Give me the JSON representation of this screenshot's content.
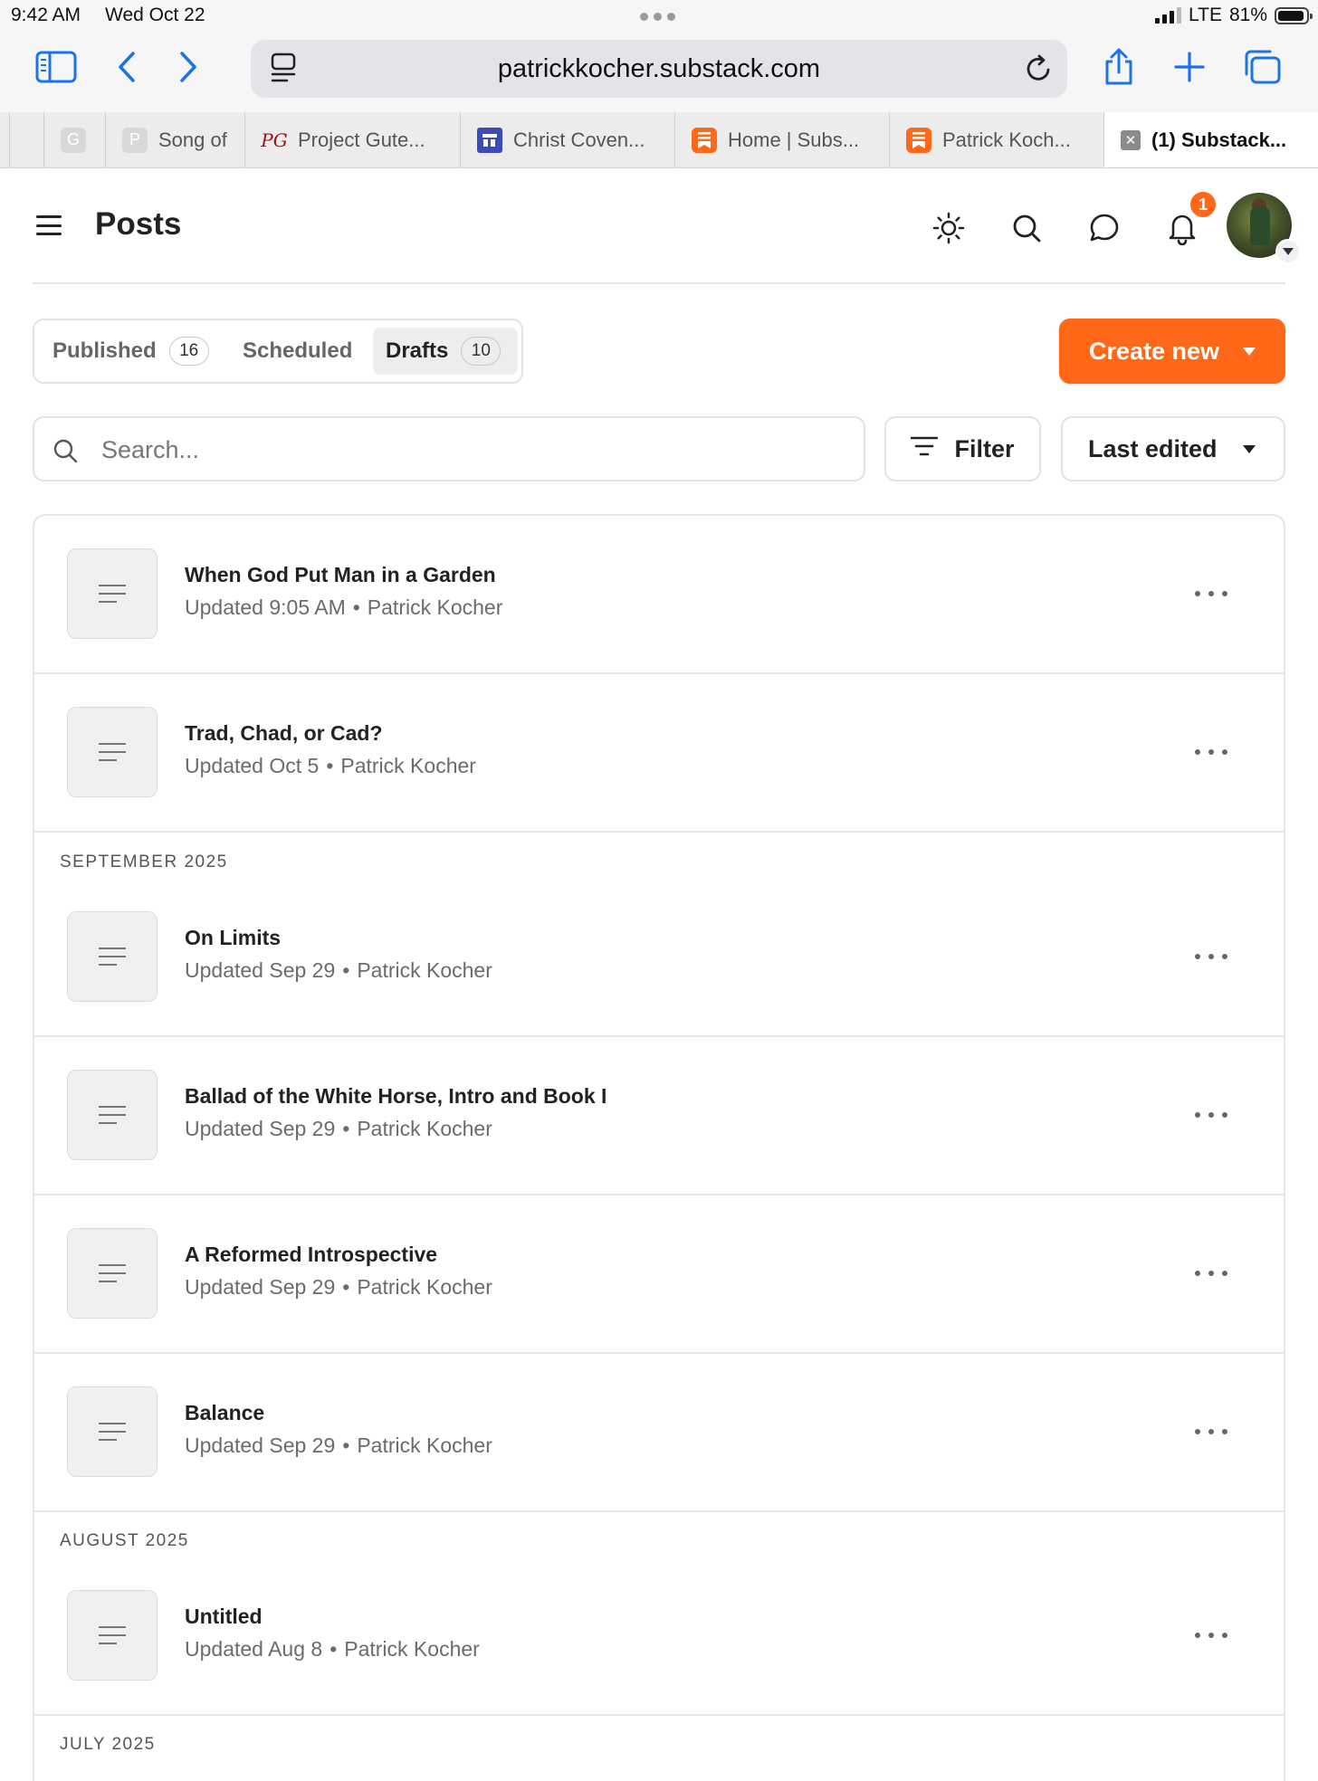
{
  "status_bar": {
    "time": "9:42 AM",
    "date": "Wed Oct 22",
    "network": "LTE",
    "battery": "81%",
    "battery_level": 0.81
  },
  "browser": {
    "url_host": "patrickkocher.substack.com",
    "tabs": [
      {
        "label": "",
        "favicon": "G"
      },
      {
        "label": "Song of",
        "favicon": "P"
      },
      {
        "label": "Project Gute...",
        "favicon": "PG"
      },
      {
        "label": "Christ Coven...",
        "favicon": "calendar-icon"
      },
      {
        "label": "Home | Subs...",
        "favicon": "substack-icon"
      },
      {
        "label": "Patrick Koch...",
        "favicon": "substack-icon"
      },
      {
        "label": "(1) Substack...",
        "favicon": "close-icon",
        "active": true
      }
    ]
  },
  "header": {
    "title": "Posts",
    "notification_count": "1"
  },
  "post_tabs": [
    {
      "label": "Published",
      "count": "16"
    },
    {
      "label": "Scheduled"
    },
    {
      "label": "Drafts",
      "count": "10",
      "active": true
    }
  ],
  "create_button": {
    "label": "Create new"
  },
  "search": {
    "placeholder": "Search..."
  },
  "filter_button": {
    "label": "Filter"
  },
  "sort_button": {
    "label": "Last edited"
  },
  "sections": [
    "SEPTEMBER 2025",
    "AUGUST 2025",
    "JULY 2025"
  ],
  "posts": [
    {
      "title": "When God Put Man in a Garden",
      "updated": "Updated 9:05 AM",
      "author": "Patrick Kocher"
    },
    {
      "title": "Trad, Chad, or Cad?",
      "updated": "Updated Oct 5",
      "author": "Patrick Kocher"
    },
    {
      "title": "On Limits",
      "updated": "Updated Sep 29",
      "author": "Patrick Kocher"
    },
    {
      "title": "Ballad of the White Horse, Intro and Book I",
      "updated": "Updated Sep 29",
      "author": "Patrick Kocher"
    },
    {
      "title": "A Reformed Introspective",
      "updated": "Updated Sep 29",
      "author": "Patrick Kocher"
    },
    {
      "title": "Balance",
      "updated": "Updated Sep 29",
      "author": "Patrick Kocher"
    },
    {
      "title": "Untitled",
      "updated": "Updated Aug 8",
      "author": "Patrick Kocher"
    }
  ],
  "colors": {
    "accent": "#ff6719",
    "ios_blue": "#1a73e8",
    "border": "#e6e6e6"
  }
}
